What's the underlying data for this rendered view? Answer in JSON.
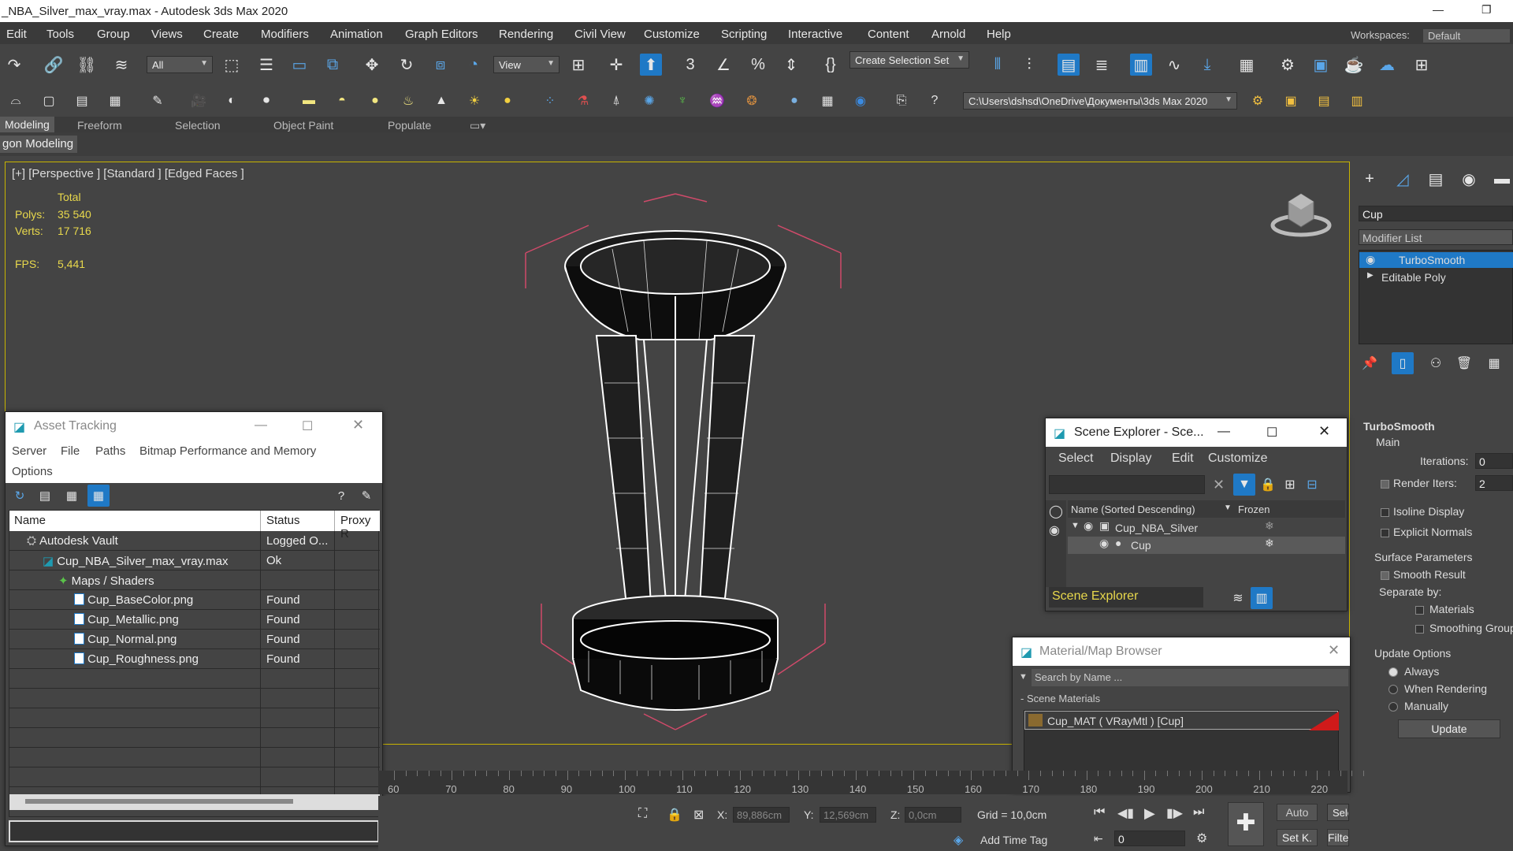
{
  "window": {
    "title": "_NBA_Silver_max_vray.max - Autodesk 3ds Max 2020",
    "minimize": "—",
    "restore": "❐"
  },
  "menu": {
    "items": [
      "Edit",
      "Tools",
      "Group",
      "Views",
      "Create",
      "Modifiers",
      "Animation",
      "Graph Editors",
      "Rendering",
      "Civil View",
      "Customize",
      "Scripting",
      "Interactive",
      "Content",
      "Arnold",
      "Help"
    ],
    "workspaces_label": "Workspaces:",
    "workspaces_value": "Default"
  },
  "toolbar": {
    "filter_value": "All",
    "ref_coord_value": "View",
    "selection_set_value": "Create Selection Set",
    "project_path": "C:\\Users\\dshsd\\OneDrive\\Документы\\3ds Max 2020"
  },
  "ribbon": {
    "tabs": [
      "Modeling",
      "Freeform",
      "Selection",
      "Object Paint",
      "Populate"
    ],
    "panel": "gon Modeling"
  },
  "viewport": {
    "label": "[+] [Perspective ] [Standard ] [Edged Faces ]",
    "stats_header": "Total",
    "polys_label": "Polys:",
    "polys_value": "35 540",
    "verts_label": "Verts:",
    "verts_value": "17 716",
    "fps_label": "FPS:",
    "fps_value": "5,441"
  },
  "asset_tracking": {
    "title": "Asset Tracking",
    "menu": [
      "Server",
      "File",
      "Paths",
      "Bitmap Performance and Memory",
      "Options"
    ],
    "columns": [
      "Name",
      "Status",
      "Proxy R"
    ],
    "rows": [
      {
        "name": "Autodesk Vault",
        "status": "Logged O...",
        "indent": 0,
        "icon": "vault"
      },
      {
        "name": "Cup_NBA_Silver_max_vray.max",
        "status": "Ok",
        "indent": 1,
        "icon": "max"
      },
      {
        "name": "Maps / Shaders",
        "status": "",
        "indent": 2,
        "icon": "maps"
      },
      {
        "name": "Cup_BaseColor.png",
        "status": "Found",
        "indent": 3,
        "icon": "file"
      },
      {
        "name": "Cup_Metallic.png",
        "status": "Found",
        "indent": 3,
        "icon": "file"
      },
      {
        "name": "Cup_Normal.png",
        "status": "Found",
        "indent": 3,
        "icon": "file"
      },
      {
        "name": "Cup_Roughness.png",
        "status": "Found",
        "indent": 3,
        "icon": "file"
      }
    ]
  },
  "scene_explorer": {
    "title": "Scene Explorer - Sce...",
    "menu": [
      "Select",
      "Display",
      "Edit",
      "Customize"
    ],
    "col_name": "Name (Sorted Descending)",
    "col_frozen": "Frozen",
    "rows": [
      "Cup_NBA_Silver",
      "Cup"
    ],
    "footer_value": "Scene Explorer"
  },
  "material_browser": {
    "title": "Material/Map Browser",
    "search_placeholder": "Search by Name ...",
    "section": "- Scene Materials",
    "material": "Cup_MAT  ( VRayMtl )  [Cup]"
  },
  "command_panel": {
    "object_name": "Cup",
    "modifier_list": "Modifier List",
    "stack": [
      "TurboSmooth",
      "Editable Poly"
    ],
    "rollout": "TurboSmooth",
    "main_label": "Main",
    "iterations_label": "Iterations:",
    "iterations_value": "0",
    "render_iters_label": "Render Iters:",
    "render_iters_value": "2",
    "isoline_label": "Isoline Display",
    "explicit_label": "Explicit Normals",
    "surface_label": "Surface Parameters",
    "smooth_label": "Smooth Result",
    "separate_label": "Separate by:",
    "materials_label": "Materials",
    "smoothing_label": "Smoothing Groups",
    "update_options_label": "Update Options",
    "always_label": "Always",
    "when_rendering_label": "When Rendering",
    "manually_label": "Manually",
    "update_button": "Update"
  },
  "timeline": {
    "ticks": [
      "60",
      "70",
      "80",
      "90",
      "100",
      "110",
      "120",
      "130",
      "140",
      "150",
      "160",
      "170",
      "180",
      "190",
      "200",
      "210",
      "220"
    ]
  },
  "status": {
    "x_label": "X:",
    "x_value": "89,886cm",
    "y_label": "Y:",
    "y_value": "12,569cm",
    "z_label": "Z:",
    "z_value": "0,0cm",
    "grid": "Grid = 10,0cm",
    "add_time_tag": "Add Time Tag",
    "frame_value": "0",
    "auto": "Auto",
    "setk": "Set K.",
    "selected_value": "Selected",
    "filters": "Filters..."
  },
  "colors": {
    "accent": "#1f79c6",
    "viewport_border": "#c8b400",
    "stat_text": "#e8d84c"
  }
}
